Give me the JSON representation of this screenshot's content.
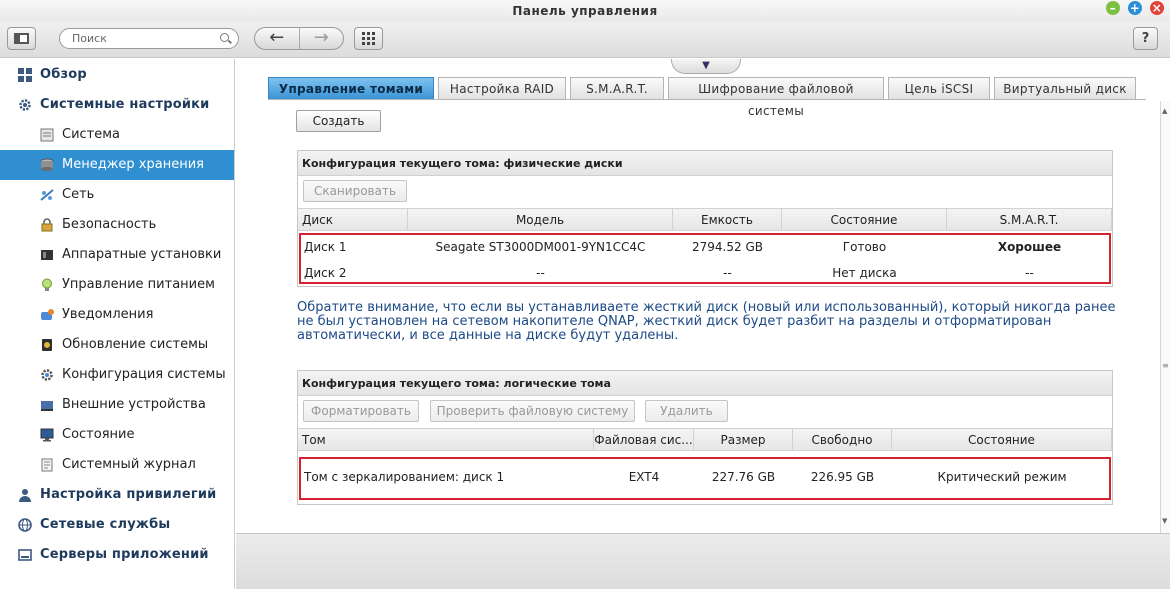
{
  "window": {
    "title": "Панель управления",
    "controls": [
      "minimize",
      "maximize",
      "close"
    ],
    "control_colors": {
      "minimize": "#7cc043",
      "maximize": "#2a8fd6",
      "close": "#e0433d"
    }
  },
  "toolbar": {
    "search_placeholder": "Поиск",
    "back_icon": "←",
    "forward_icon": "→",
    "help_label": "?"
  },
  "sidebar": {
    "accent": "#2f8fd0",
    "items": [
      {
        "label": "Обзор",
        "level": "category"
      },
      {
        "label": "Системные настройки",
        "level": "category"
      },
      {
        "label": "Система",
        "level": "sub"
      },
      {
        "label": "Менеджер хранения",
        "level": "sub",
        "active": true
      },
      {
        "label": "Сеть",
        "level": "sub"
      },
      {
        "label": "Безопасность",
        "level": "sub"
      },
      {
        "label": "Аппаратные установки",
        "level": "sub"
      },
      {
        "label": "Управление питанием",
        "level": "sub"
      },
      {
        "label": "Уведомления",
        "level": "sub"
      },
      {
        "label": "Обновление системы",
        "level": "sub"
      },
      {
        "label": "Конфигурация системы",
        "level": "sub"
      },
      {
        "label": "Внешние устройства",
        "level": "sub"
      },
      {
        "label": "Состояние",
        "level": "sub"
      },
      {
        "label": "Системный журнал",
        "level": "sub"
      },
      {
        "label": "Настройка привилегий",
        "level": "category"
      },
      {
        "label": "Сетевые службы",
        "level": "category"
      },
      {
        "label": "Серверы приложений",
        "level": "category"
      }
    ]
  },
  "tabs": [
    {
      "label": "Управление томами",
      "active": true
    },
    {
      "label": "Настройка RAID"
    },
    {
      "label": "S.M.A.R.T."
    },
    {
      "label": "Шифрование файловой системы"
    },
    {
      "label": "Цель iSCSI"
    },
    {
      "label": "Виртуальный диск"
    }
  ],
  "create_button": "Создать",
  "physical": {
    "title": "Конфигурация текущего тома: физические диски",
    "scan_button": "Сканировать",
    "columns": [
      "Диск",
      "Модель",
      "Емкость",
      "Состояние",
      "S.M.A.R.T."
    ],
    "rows": [
      [
        "Диск 1",
        "Seagate ST3000DM001-9YN1CC4C",
        "2794.52 GB",
        "Готово",
        "Хорошее"
      ],
      [
        "Диск 2",
        "--",
        "--",
        "Нет диска",
        "--"
      ]
    ]
  },
  "notice": "Обратите внимание, что если вы устанавливаете жесткий диск (новый или использованный), который никогда ранее не был установлен на сетевом накопителе QNAP, жесткий диск будет разбит на разделы и отформатирован автоматически, и все данные на диске будут удалены.",
  "logical": {
    "title": "Конфигурация текущего тома: логические тома",
    "format_button": "Форматировать",
    "check_button": "Проверить файловую систему",
    "delete_button": "Удалить",
    "columns": [
      "Том",
      "Файловая сис...",
      "Размер",
      "Свободно",
      "Состояние"
    ],
    "rows": [
      [
        "Том с зеркалированием: диск 1",
        "EXT4",
        "227.76 GB",
        "226.95 GB",
        "Критический режим"
      ]
    ]
  },
  "colors": {
    "smart_good": "#1a7d10",
    "highlight_box": "#d4232f",
    "notice_text": "#1d4a86"
  }
}
